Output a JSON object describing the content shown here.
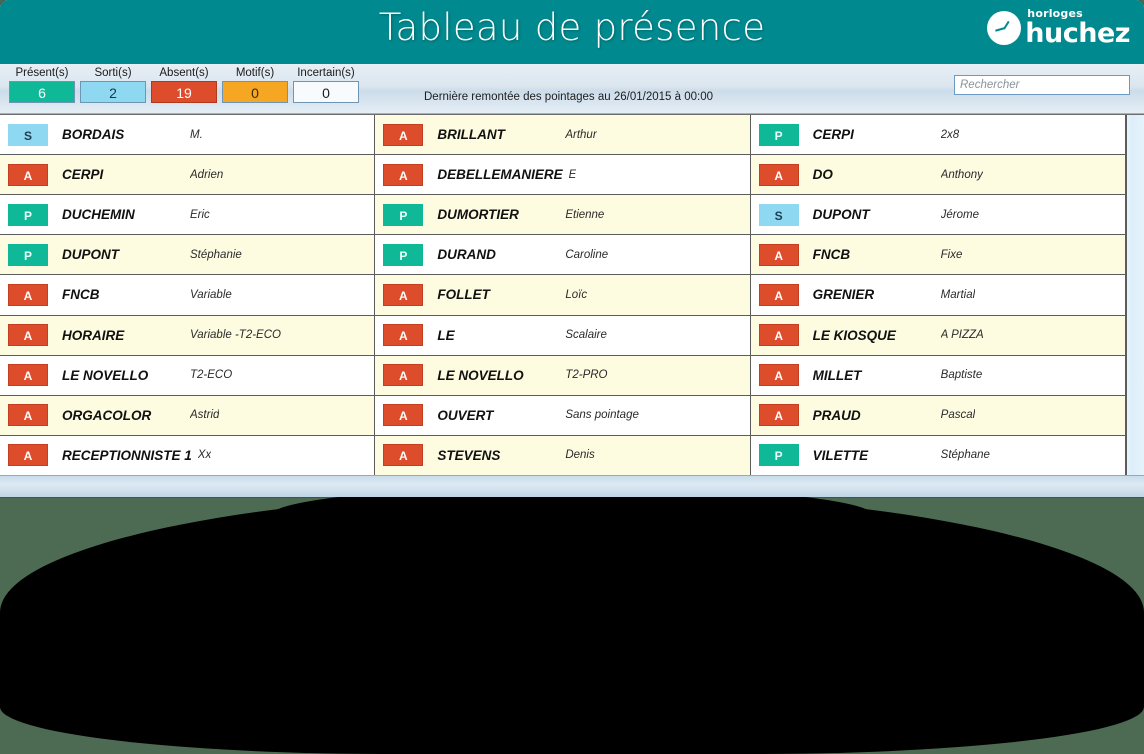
{
  "header": {
    "title": "Tableau de présence",
    "brand_sub": "horloges",
    "brand_name": "huchez",
    "brand_icon": "clock-icon"
  },
  "toolbar": {
    "stats": [
      {
        "label": "Présent(s)",
        "value": "6",
        "kind": "present",
        "color": "#0fb998"
      },
      {
        "label": "Sorti(s)",
        "value": "2",
        "kind": "sorti",
        "color": "#8fd8f2"
      },
      {
        "label": "Absent(s)",
        "value": "19",
        "kind": "absent",
        "color": "#dd4d2c"
      },
      {
        "label": "Motif(s)",
        "value": "0",
        "kind": "motif",
        "color": "#f5a623"
      },
      {
        "label": "Incertain(s)",
        "value": "0",
        "kind": "incertain",
        "color": "#f7fbfd"
      }
    ],
    "last_sync": "Dernière remontée des pointages au 26/01/2015 à 00:00",
    "search_placeholder": "Rechercher",
    "search_value": ""
  },
  "table": {
    "columns": [
      {
        "rows": [
          {
            "status": "S",
            "name": "BORDAIS",
            "detail": "M."
          },
          {
            "status": "A",
            "name": "CERPI",
            "detail": "Adrien"
          },
          {
            "status": "P",
            "name": "DUCHEMIN",
            "detail": "Eric"
          },
          {
            "status": "P",
            "name": "DUPONT",
            "detail": "Stéphanie"
          },
          {
            "status": "A",
            "name": "FNCB",
            "detail": "Variable"
          },
          {
            "status": "A",
            "name": "HORAIRE",
            "detail": "Variable -T2-ECO"
          },
          {
            "status": "A",
            "name": "LE NOVELLO",
            "detail": "T2-ECO"
          },
          {
            "status": "A",
            "name": "ORGACOLOR",
            "detail": "Astrid"
          },
          {
            "status": "A",
            "name": "RECEPTIONNISTE 1",
            "detail": "Xx"
          }
        ]
      },
      {
        "rows": [
          {
            "status": "A",
            "name": "BRILLANT",
            "detail": "Arthur"
          },
          {
            "status": "A",
            "name": "DEBELLEMANIERE",
            "detail": "E"
          },
          {
            "status": "P",
            "name": "DUMORTIER",
            "detail": "Etienne"
          },
          {
            "status": "P",
            "name": "DURAND",
            "detail": "Caroline"
          },
          {
            "status": "A",
            "name": "FOLLET",
            "detail": "Loïc"
          },
          {
            "status": "A",
            "name": "LE",
            "detail": "Scalaire"
          },
          {
            "status": "A",
            "name": "LE NOVELLO",
            "detail": "T2-PRO"
          },
          {
            "status": "A",
            "name": "OUVERT",
            "detail": "Sans pointage"
          },
          {
            "status": "A",
            "name": "STEVENS",
            "detail": "Denis"
          }
        ]
      },
      {
        "rows": [
          {
            "status": "P",
            "name": "CERPI",
            "detail": "2x8"
          },
          {
            "status": "A",
            "name": "DO",
            "detail": "Anthony"
          },
          {
            "status": "S",
            "name": "DUPONT",
            "detail": "Jérome"
          },
          {
            "status": "A",
            "name": "FNCB",
            "detail": "Fixe"
          },
          {
            "status": "A",
            "name": "GRENIER",
            "detail": "Martial"
          },
          {
            "status": "A",
            "name": "LE KIOSQUE",
            "detail": "A PIZZA"
          },
          {
            "status": "A",
            "name": "MILLET",
            "detail": "Baptiste"
          },
          {
            "status": "A",
            "name": "PRAUD",
            "detail": "Pascal"
          },
          {
            "status": "P",
            "name": "VILETTE",
            "detail": "Stéphane"
          }
        ]
      }
    ]
  }
}
